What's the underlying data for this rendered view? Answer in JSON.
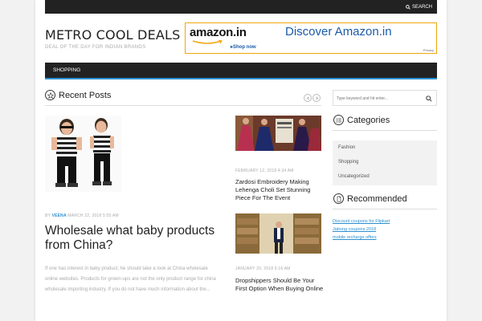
{
  "header": {
    "search_label": "SEARCH",
    "site_title": "METRO COOL DEALS",
    "tagline": "DEAL OF THE DAY FOR INDIAN BRANDS"
  },
  "banner": {
    "logo_text": "amazon.in",
    "shop_now": "▸Shop now",
    "discover": "Discover Amazon.in",
    "privacy": "Privacy"
  },
  "nav": {
    "items": [
      "SHOPPING"
    ]
  },
  "recent": {
    "heading": "Recent Posts",
    "main_post": {
      "meta_by": "BY",
      "author": "VEENA",
      "date": "MARCH 22, 2018 5:55 AM",
      "title": "Wholesale what baby products from China?",
      "excerpt": "If one has interest in baby product, he should take a look at China wholesale online websites. Products for grown-ups are not the only product range for china wholesale importing industry. If you do not have much information about the..."
    },
    "side_posts": [
      {
        "date": "FEBRUARY 12, 2018 4:34 AM",
        "title": "Zardosi Embroidery Making Lehenga Choli Set Stunning Piece For The Event"
      },
      {
        "date": "JANUARY 20, 2018 5:16 AM",
        "title": "Dropshippers Should Be Your First Option When Buying Online"
      }
    ]
  },
  "sidebar": {
    "search_placeholder": "Type keyword and hit enter...",
    "categories_heading": "Categories",
    "categories": [
      "Fashion",
      "Shopping",
      "Uncategorized"
    ],
    "recommended_heading": "Recommended",
    "recommended_links": [
      "Discount coupons for Flipkart",
      "Jabong coupons 2018",
      "mobile recharge offers"
    ]
  },
  "colors": {
    "accent": "#2a8fd0",
    "dark_bar": "#222222",
    "banner_border": "#f0a60a"
  }
}
